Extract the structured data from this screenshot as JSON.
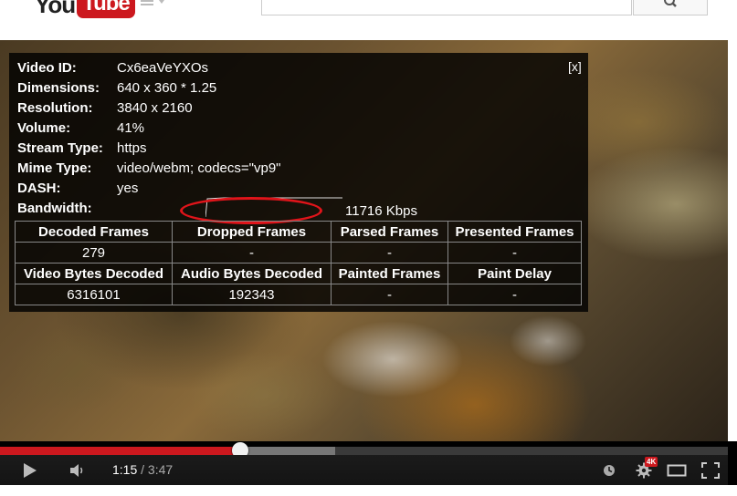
{
  "header": {
    "logo_you": "You",
    "logo_tube": "Tube"
  },
  "stats": {
    "close": "[x]",
    "rows": [
      {
        "label": "Video ID:",
        "value": "Cx6eaVeYXOs"
      },
      {
        "label": "Dimensions:",
        "value": "640 x 360 * 1.25"
      },
      {
        "label": "Resolution:",
        "value": "3840 x 2160"
      },
      {
        "label": "Volume:",
        "value": "41%"
      },
      {
        "label": "Stream Type:",
        "value": "https"
      },
      {
        "label": "Mime Type:",
        "value": "video/webm; codecs=\"vp9\""
      },
      {
        "label": "DASH:",
        "value": "yes"
      },
      {
        "label": "Bandwidth:",
        "value": ""
      }
    ],
    "bandwidth": "11716 Kbps",
    "table": {
      "header1": [
        "Decoded Frames",
        "Dropped Frames",
        "Parsed Frames",
        "Presented Frames"
      ],
      "values1": [
        "279",
        "-",
        "-",
        "-"
      ],
      "header2": [
        "Video Bytes Decoded",
        "Audio Bytes Decoded",
        "Painted Frames",
        "Paint Delay"
      ],
      "values2": [
        "6316101",
        "192343",
        "-",
        "-"
      ]
    },
    "highlight_color": "#e0141a"
  },
  "player": {
    "time_current": "1:15",
    "time_separator": " / ",
    "time_duration": "3:47",
    "played_fraction": 0.33,
    "buffered_fraction": 0.46,
    "quality_badge": "4K",
    "accent_color": "#cc181e"
  },
  "icons": [
    "search-icon",
    "guide-menu-icon",
    "play-icon",
    "volume-icon",
    "watch-later-icon",
    "settings-gear-icon",
    "theater-mode-icon",
    "fullscreen-icon"
  ]
}
